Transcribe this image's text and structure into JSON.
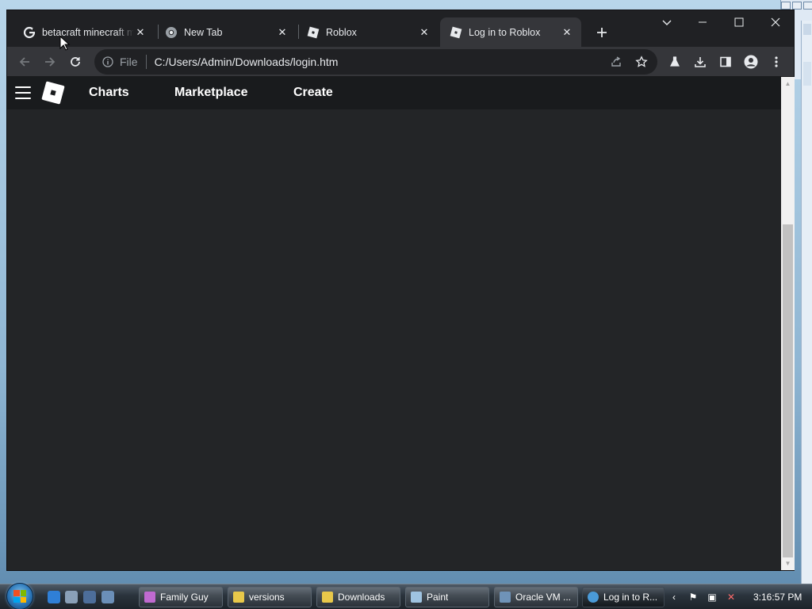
{
  "browser": {
    "tabs": [
      {
        "title": "betacraft minecraft m",
        "favicon": "google-g-icon",
        "active": false
      },
      {
        "title": "New Tab",
        "favicon": "chrome-icon",
        "active": false
      },
      {
        "title": "Roblox",
        "favicon": "roblox-icon",
        "active": false
      },
      {
        "title": "Log in to Roblox",
        "favicon": "roblox-icon",
        "active": true
      }
    ],
    "address": {
      "scheme_label": "File",
      "url": "C:/Users/Admin/Downloads/login.htm"
    }
  },
  "site": {
    "nav_links": [
      "Charts",
      "Marketplace",
      "Create"
    ]
  },
  "taskbar": {
    "items": [
      {
        "label": "Family Guy",
        "icon_color": "#c06ad0"
      },
      {
        "label": "versions",
        "icon_color": "#e8c84a"
      },
      {
        "label": "Downloads",
        "icon_color": "#e8c84a"
      },
      {
        "label": "Paint",
        "icon_color": "#9fc3e0"
      },
      {
        "label": "Oracle VM ...",
        "icon_color": "#6f93b8"
      },
      {
        "label": "Log in to R...",
        "icon_color": "#4a9ad8"
      }
    ],
    "clock": "3:16:57 PM"
  },
  "colors": {
    "page_bg": "#232527",
    "site_nav_bg": "#191b1d",
    "browser_frame": "#202124",
    "toolbar": "#35363a"
  }
}
